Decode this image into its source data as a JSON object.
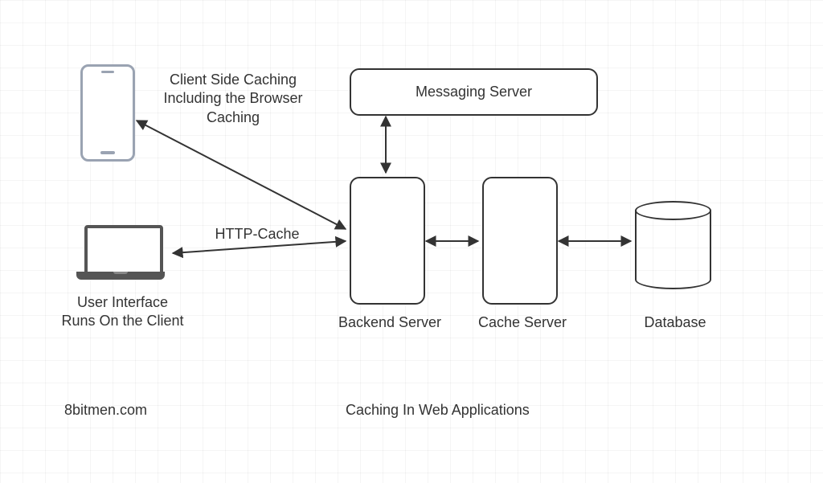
{
  "title": "Caching In Web Applications",
  "attribution": "8bitmen.com",
  "nodes": {
    "phone_label": "",
    "client_caching": "Client Side Caching\nIncluding the Browser\nCaching",
    "laptop_label": "User Interface\nRuns On the Client",
    "http_cache": "HTTP-Cache",
    "messaging_server": "Messaging Server",
    "backend_server": "Backend Server",
    "cache_server": "Cache Server",
    "database": "Database"
  }
}
